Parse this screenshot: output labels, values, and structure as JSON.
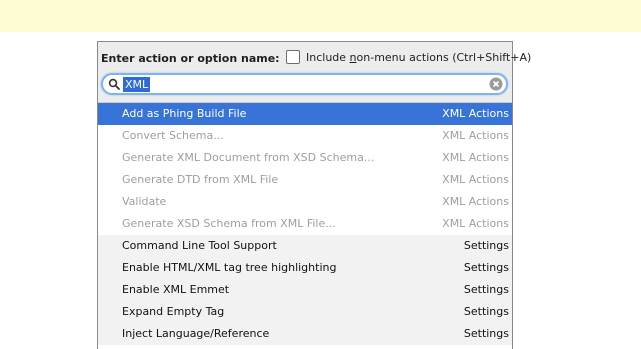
{
  "dialog": {
    "title": "Enter action or option name:",
    "include_nonmenu_label": {
      "before": "Include ",
      "underlined": "n",
      "after": "on-menu actions (Ctrl+Shift+A)"
    },
    "include_nonmenu_checked": false,
    "search_value": "XML"
  },
  "results": [
    {
      "name": "Add as Phing Build File",
      "group": "XML Actions",
      "state": "selected"
    },
    {
      "name": "Convert Schema...",
      "group": "XML Actions",
      "state": "disabled"
    },
    {
      "name": "Generate XML Document from XSD Schema...",
      "group": "XML Actions",
      "state": "disabled"
    },
    {
      "name": "Generate DTD from XML File",
      "group": "XML Actions",
      "state": "disabled"
    },
    {
      "name": "Validate",
      "group": "XML Actions",
      "state": "disabled"
    },
    {
      "name": "Generate XSD Schema from XML File...",
      "group": "XML Actions",
      "state": "disabled"
    },
    {
      "name": "Command Line Tool Support",
      "group": "Settings",
      "state": "enabled"
    },
    {
      "name": "Enable HTML/XML tag tree highlighting",
      "group": "Settings",
      "state": "enabled"
    },
    {
      "name": "Enable XML Emmet",
      "group": "Settings",
      "state": "enabled"
    },
    {
      "name": "Expand Empty Tag",
      "group": "Settings",
      "state": "enabled"
    },
    {
      "name": "Inject Language/Reference",
      "group": "Settings",
      "state": "enabled"
    }
  ],
  "colors": {
    "selection": "#3874d8",
    "hint_bar": "#fefcd2",
    "disabled_text": "#9e9e9e",
    "search_focus": "#7fb3ea"
  }
}
